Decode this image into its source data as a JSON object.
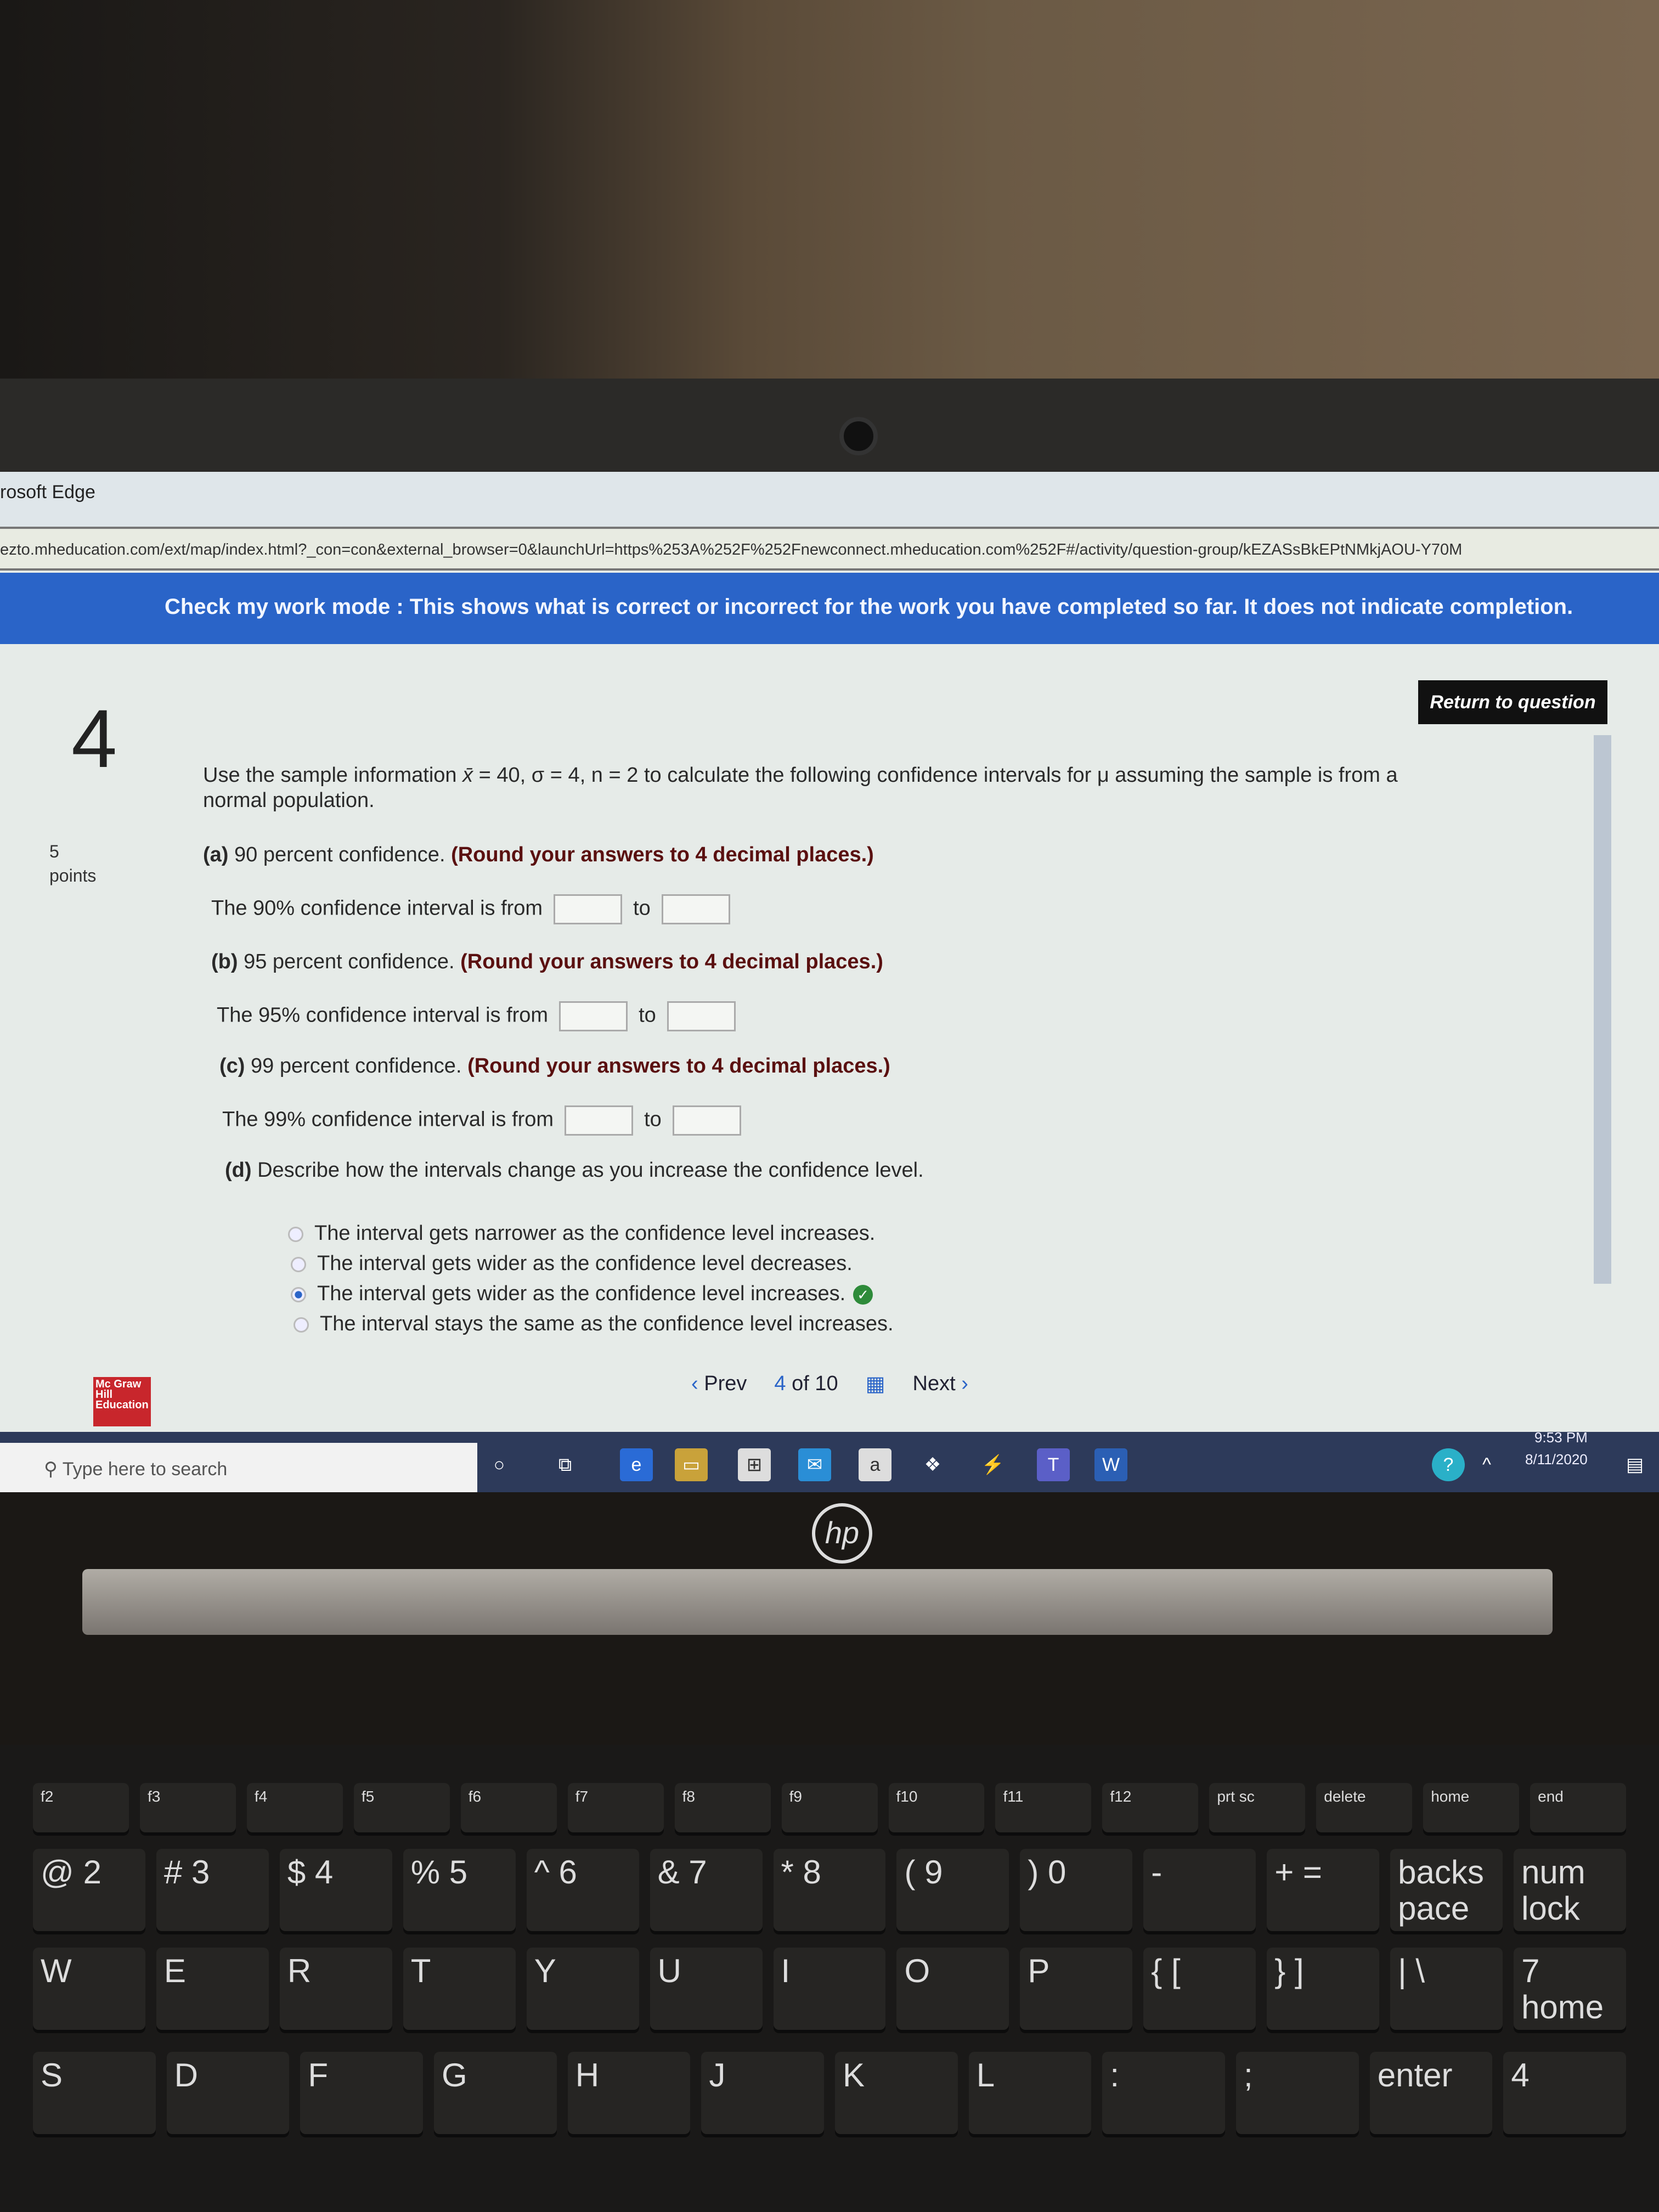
{
  "browser": {
    "title": "rosoft Edge",
    "url": "ezto.mheducation.com/ext/map/index.html?_con=con&external_browser=0&launchUrl=https%253A%252F%252Fnewconnect.mheducation.com%252F#/activity/question-group/kEZASsBkEPtNMkjAOU-Y70M"
  },
  "banner": "Check my work mode : This shows what is correct or incorrect for the work you have completed so far. It does not indicate completion.",
  "question": {
    "number": "4",
    "points_value": "5",
    "points_label": "points",
    "return_button": "Return to question",
    "prompt_a": "Use the sample information ",
    "xbar": "x̄",
    "prompt_b": " = 40, σ = 4, n = 2 to calculate the following confidence intervals for μ assuming the sample is from a normal population.",
    "parts": [
      {
        "label": "(a)",
        "text": " 90 percent confidence. ",
        "note": "(Round your answers to 4 decimal places.)",
        "row": "The 90% confidence interval is from",
        "to": "to"
      },
      {
        "label": "(b)",
        "text": " 95 percent confidence. ",
        "note": "(Round your answers to 4 decimal places.)",
        "row": "The 95% confidence interval is from",
        "to": "to"
      },
      {
        "label": "(c)",
        "text": " 99 percent confidence. ",
        "note": "(Round your answers to 4 decimal places.)",
        "row": "The 99% confidence interval is from",
        "to": "to"
      }
    ],
    "part_d": {
      "label": "(d)",
      "text": " Describe how the intervals change as you increase the confidence level.",
      "options": [
        "The interval gets narrower as the confidence level increases.",
        "The interval gets wider as the confidence level decreases.",
        "The interval gets wider as the confidence level increases.",
        "The interval stays the same as the confidence level increases."
      ],
      "selected": 2,
      "selected_correct": true
    }
  },
  "logo": "Mc Graw Hill Education",
  "nav": {
    "prev": "Prev",
    "page": "4",
    "of": "of 10",
    "next": "Next"
  },
  "taskbar": {
    "search_placeholder": "Type here to search",
    "time": "9:53 PM",
    "date": "8/11/2020"
  },
  "laptop": {
    "brand": "hp",
    "keys": [
      [
        "f2",
        "f3",
        "f4",
        "f5",
        "f6",
        "f7",
        "f8",
        "f9",
        "f10",
        "f11",
        "f12",
        "prt sc",
        "delete",
        "home",
        "end"
      ],
      [
        "@ 2",
        "# 3",
        "$ 4",
        "% 5",
        "^ 6",
        "& 7",
        "* 8",
        "( 9",
        ") 0",
        "-",
        "+ =",
        "backspace",
        "num lock"
      ],
      [
        "W",
        "E",
        "R",
        "T",
        "Y",
        "U",
        "I",
        "O",
        "P",
        "{ [",
        "} ]",
        "| \\",
        "7 home"
      ],
      [
        "S",
        "D",
        "F",
        "G",
        "H",
        "J",
        "K",
        "L",
        ":",
        ";",
        "enter",
        "4"
      ]
    ]
  }
}
